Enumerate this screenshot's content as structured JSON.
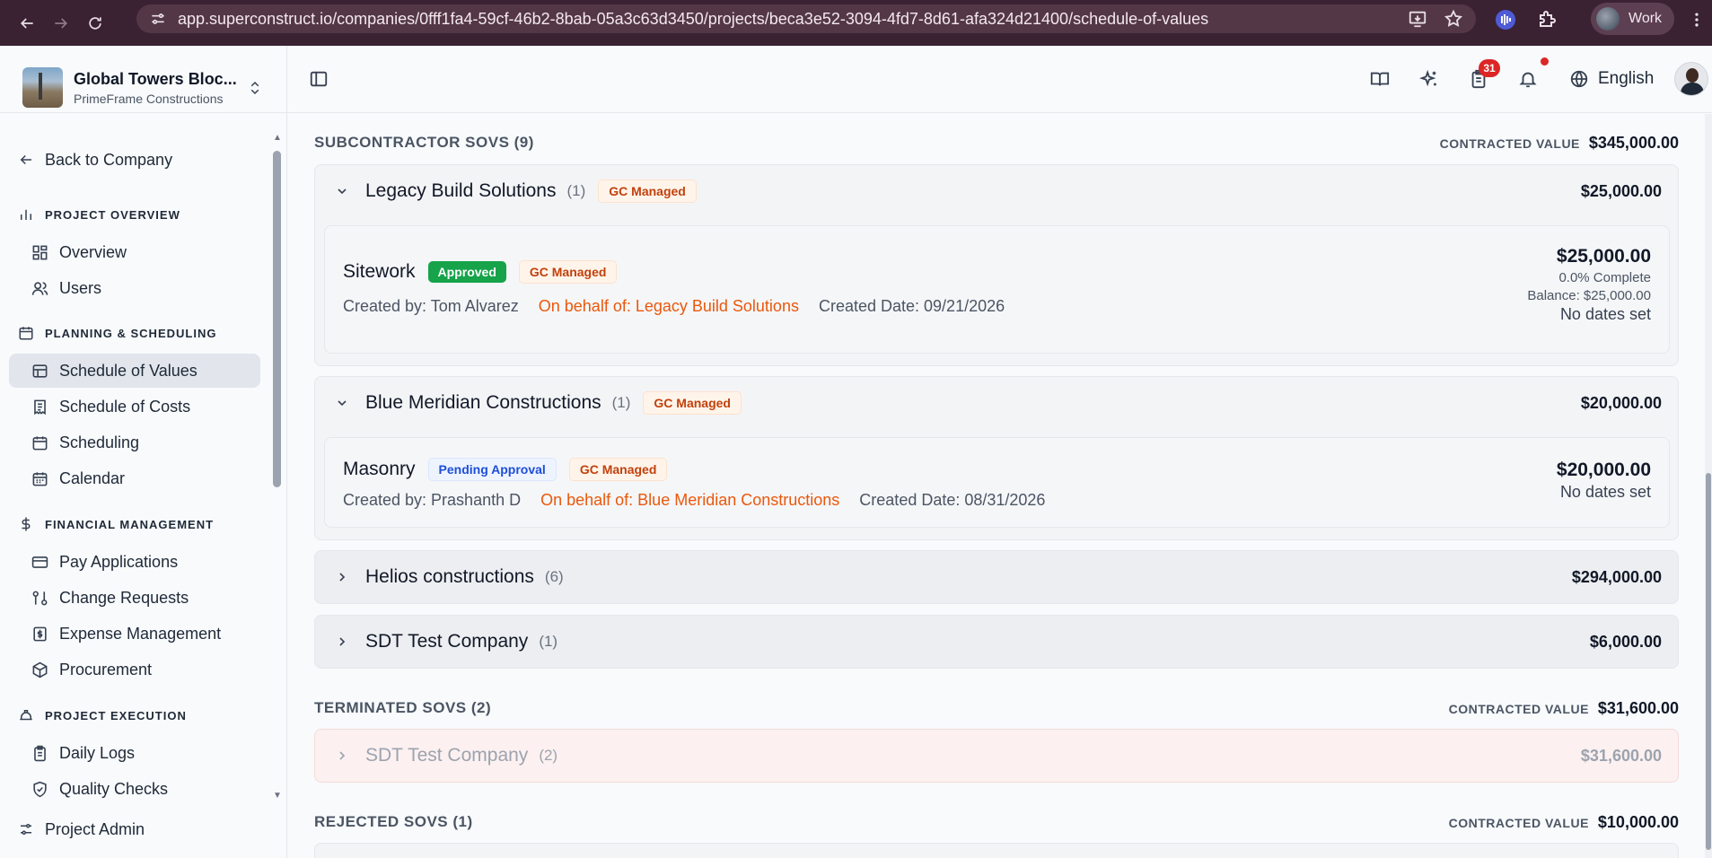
{
  "browser": {
    "url": "app.superconstruct.io/companies/0fff1fa4-59cf-46b2-8bab-05a3c63d3450/projects/beca3e52-3094-4fd7-8d61-afa324d21400/schedule-of-values",
    "profile_label": "Work"
  },
  "project": {
    "name": "Global Towers Bloc...",
    "company": "PrimeFrame Constructions"
  },
  "sidebar": {
    "back_label": "Back to Company",
    "sections": {
      "overview": {
        "title": "PROJECT OVERVIEW",
        "items": [
          "Overview",
          "Users"
        ]
      },
      "planning": {
        "title": "PLANNING & SCHEDULING",
        "items": [
          "Schedule of Values",
          "Schedule of Costs",
          "Scheduling",
          "Calendar"
        ]
      },
      "financial": {
        "title": "FINANCIAL MANAGEMENT",
        "items": [
          "Pay Applications",
          "Change Requests",
          "Expense Management",
          "Procurement"
        ]
      },
      "execution": {
        "title": "PROJECT EXECUTION",
        "items": [
          "Daily Logs",
          "Quality Checks"
        ]
      }
    },
    "admin_label": "Project Admin",
    "active_item": "Schedule of Values"
  },
  "topbar": {
    "tasks_badge": "31",
    "language": "English"
  },
  "subcontractor": {
    "title": "SUBCONTRACTOR SOVS (9)",
    "contracted_label": "CONTRACTED VALUE",
    "contracted_value": "$345,000.00",
    "groups": [
      {
        "name": "Legacy Build Solutions",
        "count": "(1)",
        "tag": "GC Managed",
        "total": "$25,000.00",
        "expanded": true,
        "item": {
          "title": "Sitework",
          "status": "Approved",
          "tag": "GC Managed",
          "created_by": "Created by: Tom Alvarez",
          "on_behalf": "On behalf of: Legacy Build Solutions",
          "created_date": "Created Date: 09/21/2026",
          "amount": "$25,000.00",
          "complete": "0.0% Complete",
          "balance": "Balance: $25,000.00",
          "dates": "No dates set"
        }
      },
      {
        "name": "Blue Meridian Constructions",
        "count": "(1)",
        "tag": "GC Managed",
        "total": "$20,000.00",
        "expanded": true,
        "item": {
          "title": "Masonry",
          "status": "Pending Approval",
          "tag": "GC Managed",
          "created_by": "Created by: Prashanth D",
          "on_behalf": "On behalf of: Blue Meridian Constructions",
          "created_date": "Created Date: 08/31/2026",
          "amount": "$20,000.00",
          "dates": "No dates set"
        }
      },
      {
        "name": "Helios constructions",
        "count": "(6)",
        "total": "$294,000.00",
        "expanded": false
      },
      {
        "name": "SDT Test Company",
        "count": "(1)",
        "total": "$6,000.00",
        "expanded": false
      }
    ]
  },
  "terminated": {
    "title": "TERMINATED SOVS (2)",
    "contracted_label": "CONTRACTED VALUE",
    "contracted_value": "$31,600.00",
    "groups": [
      {
        "name": "SDT Test Company",
        "count": "(2)",
        "total": "$31,600.00",
        "expanded": false
      }
    ]
  },
  "rejected": {
    "title": "REJECTED SOVS (1)",
    "contracted_label": "CONTRACTED VALUE",
    "contracted_value": "$10,000.00"
  },
  "colors": {
    "browser_frame": "#3a2233",
    "accent_orange": "#ea580c",
    "approved_green": "#16a34a",
    "pending_blue": "#1d4ed8",
    "badge_red": "#dc2626"
  }
}
